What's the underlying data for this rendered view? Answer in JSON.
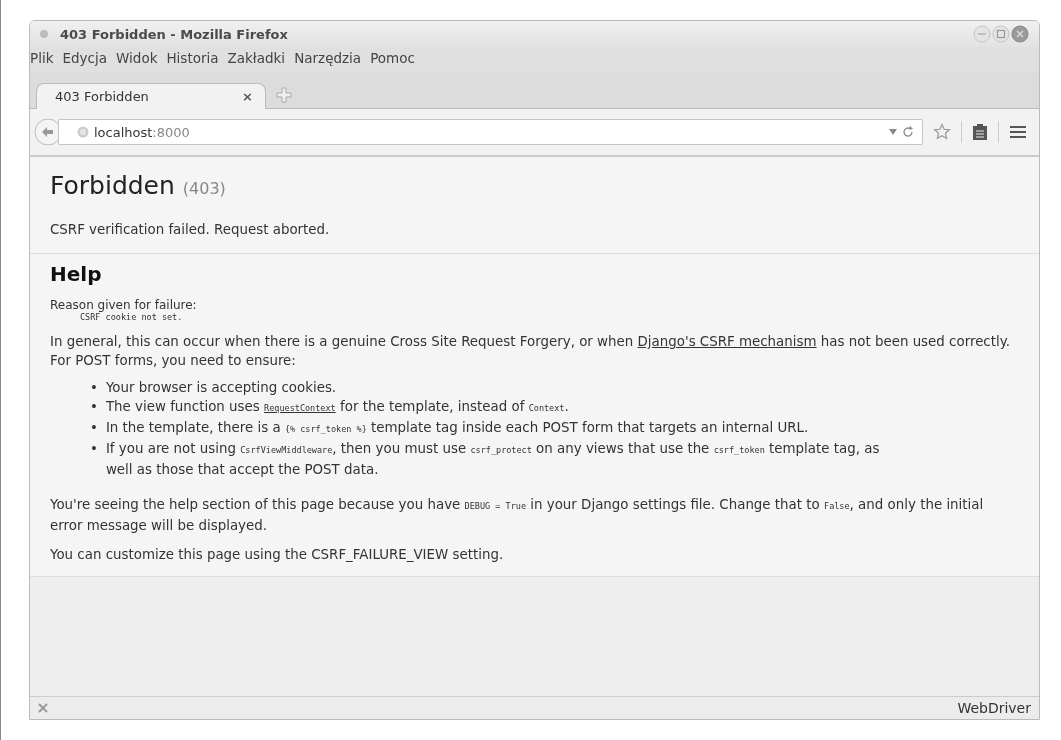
{
  "window": {
    "title": "403 Forbidden - Mozilla Firefox"
  },
  "menu": [
    {
      "label": "Plik"
    },
    {
      "label": "Edycja"
    },
    {
      "label": "Widok"
    },
    {
      "label": "Historia"
    },
    {
      "label": "Zakładki"
    },
    {
      "label": "Narzędzia"
    },
    {
      "label": "Pomoc"
    }
  ],
  "tabs": [
    {
      "label": "403 Forbidden",
      "close": "×",
      "selected": true
    }
  ],
  "address": {
    "host": "localhost",
    "port": ":8000"
  },
  "summary": {
    "title": "Forbidden",
    "code": "(403)",
    "message": "CSRF verification failed. Request aborted."
  },
  "help": {
    "title": "Help",
    "reason_label": "Reason given for failure:",
    "reason": "CSRF cookie not set.",
    "intro": [
      {
        "kind": "text",
        "text": "In general, this can occur when there is a genuine Cross Site Request Forgery, or when "
      },
      {
        "kind": "link",
        "text": "Django's CSRF mechanism"
      },
      {
        "kind": "text",
        "text": " has not been used correctly. For POST forms, you need to ensure:"
      }
    ],
    "bullets": [
      {
        "marker": "•",
        "parts": [
          {
            "kind": "text",
            "text": "Your browser is accepting cookies."
          }
        ]
      },
      {
        "marker": "•",
        "parts": [
          {
            "kind": "text",
            "text": "The view function uses "
          },
          {
            "kind": "codelink",
            "text": "RequestContext"
          },
          {
            "kind": "text",
            "text": " for the template, instead of "
          },
          {
            "kind": "code",
            "text": "Context"
          },
          {
            "kind": "text",
            "text": "."
          }
        ]
      },
      {
        "marker": "•",
        "parts": [
          {
            "kind": "text",
            "text": "In the template, there is a "
          },
          {
            "kind": "code",
            "text": "{% csrf_token %}"
          },
          {
            "kind": "text",
            "text": " template tag inside each POST form that targets an internal URL."
          }
        ]
      },
      {
        "marker": "•",
        "parts": [
          {
            "kind": "text",
            "text": "If you are not using "
          },
          {
            "kind": "code",
            "text": "CsrfViewMiddleware"
          },
          {
            "kind": "text",
            "text": ", then you must use "
          },
          {
            "kind": "code",
            "text": "csrf_protect"
          },
          {
            "kind": "text",
            "text": " on any views that use the "
          },
          {
            "kind": "code",
            "text": "csrf_token"
          },
          {
            "kind": "text",
            "text": " template tag, as well as those that accept the POST data."
          }
        ]
      }
    ],
    "debug": [
      {
        "kind": "text",
        "text": "You're seeing the help section of this page because you have "
      },
      {
        "kind": "code",
        "text": "DEBUG = True"
      },
      {
        "kind": "text",
        "text": " in your Django settings file. Change that to "
      },
      {
        "kind": "code",
        "text": "False"
      },
      {
        "kind": "text",
        "text": ", and only the initial error message will be displayed."
      }
    ],
    "customize": "You can customize this page using the CSRF_FAILURE_VIEW setting."
  },
  "status_bar": {
    "text": "WebDriver"
  }
}
